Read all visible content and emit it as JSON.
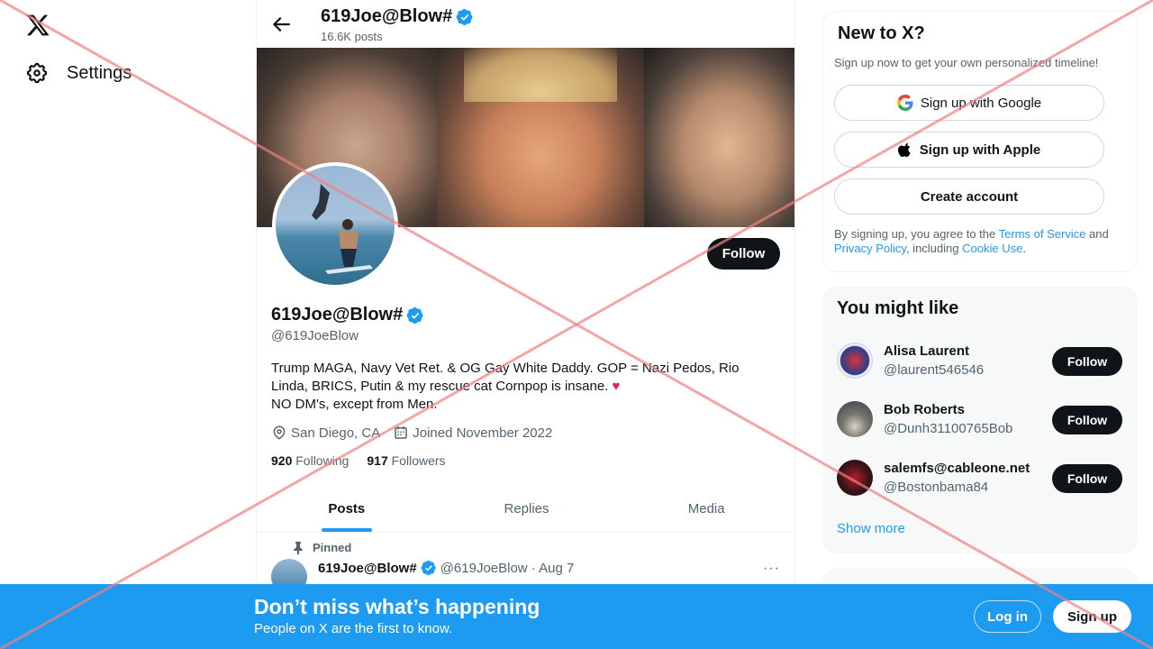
{
  "nav": {
    "settings_label": "Settings"
  },
  "header": {
    "name": "619Joe@Blow#",
    "posts_count": "16.6K posts"
  },
  "profile": {
    "name": "619Joe@Blow#",
    "handle": "@619JoeBlow",
    "follow_label": "Follow",
    "bio_line1": "Trump MAGA, Navy Vet Ret. & OG Gay White  Daddy.  GOP = Nazi Pedos, Rio Linda, BRICS, Putin & my rescue cat Cornpop is insane. ",
    "bio_line2": "NO DM's, except from Men.",
    "location": "San Diego, CA",
    "joined": "Joined November 2022",
    "following_count": "920",
    "following_label": "Following",
    "followers_count": "917",
    "followers_label": "Followers"
  },
  "tabs": [
    {
      "label": "Posts",
      "active": true
    },
    {
      "label": "Replies",
      "active": false
    },
    {
      "label": "Media",
      "active": false
    }
  ],
  "pinned_post": {
    "pinned_label": "Pinned",
    "author": "619Joe@Blow#",
    "handle_date": "@619JoeBlow · Aug 7",
    "more": "···"
  },
  "signup_card": {
    "title": "New to X?",
    "subtitle": "Sign up now to get your own personalized timeline!",
    "google_label": "Sign up with Google",
    "apple_label": "Sign up with Apple",
    "create_label": "Create account",
    "legal_prefix": "By signing up, you agree to the ",
    "terms": "Terms of Service",
    "and": " and ",
    "privacy": "Privacy Policy",
    "including": ", including ",
    "cookie": "Cookie Use",
    "period": "."
  },
  "suggestions": {
    "title": "You might like",
    "items": [
      {
        "name": "Alisa Laurent",
        "handle": "@laurent546546",
        "follow": "Follow"
      },
      {
        "name": "Bob Roberts",
        "handle": "@Dunh31100765Bob",
        "follow": "Follow"
      },
      {
        "name": "salemfs@cableone.net",
        "handle": "@Bostonbama84",
        "follow": "Follow"
      }
    ],
    "show_more": "Show more"
  },
  "bottom_bar": {
    "title": "Don’t miss what’s happening",
    "subtitle": "People on X are the first to know.",
    "login_label": "Log in",
    "signup_label": "Sign up"
  },
  "colors": {
    "accent": "#1d9bf0",
    "text": "#0f1419",
    "muted": "#536471",
    "verified": "#1d9bf0"
  }
}
